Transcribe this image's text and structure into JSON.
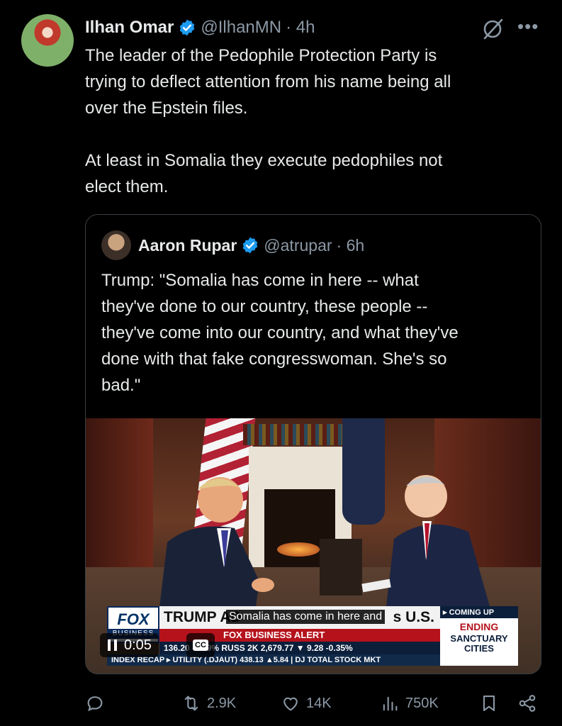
{
  "tweet": {
    "author_name": "Ilhan Omar",
    "handle": "@IlhanMN",
    "time": " · 4h",
    "text": "The leader of the Pedophile Protection Party is\ntrying to deflect attention from his name being all\nover the Epstein files.\n\nAt least in Somalia they execute pedophiles not\nelect them.",
    "icons": [
      "verified-icon",
      "grok-icon",
      "more-icon"
    ]
  },
  "quote": {
    "author_name": "Aaron Rupar",
    "handle": "@atrupar",
    "time": " · 6h",
    "text": "Trump: \"Somalia has come in here -- what\nthey've done to our country, these people --\nthey've come into our country, and what they've\ndone with that fake congresswoman. She's so\nbad.\"",
    "video": {
      "time": "0:05",
      "cc_label": "CC",
      "caption": "Somalia has come in here and",
      "fox_logo": "FOX",
      "fox_sub": "BUSINESS",
      "headline": "TRUMP AD",
      "headline_tail": "s U.S.",
      "alert": "FOX BUSINESS ALERT",
      "ticker": "136.20  -0.59%  RUSS 2K   2,679.77  ▼ 9.28  -0.35%",
      "ticker2": "INDEX RECAP  ▸ UTILITY (.DJAUT)  438.13  ▲5.84  |  DJ TOTAL STOCK MKT",
      "coming_label": "▸ COMING UP",
      "coming_title": "ENDING",
      "coming_sub": "SANCTUARY CITIES"
    }
  },
  "actions": {
    "reply": "",
    "retweets": "2.9K",
    "likes": "14K",
    "views": "750K"
  }
}
